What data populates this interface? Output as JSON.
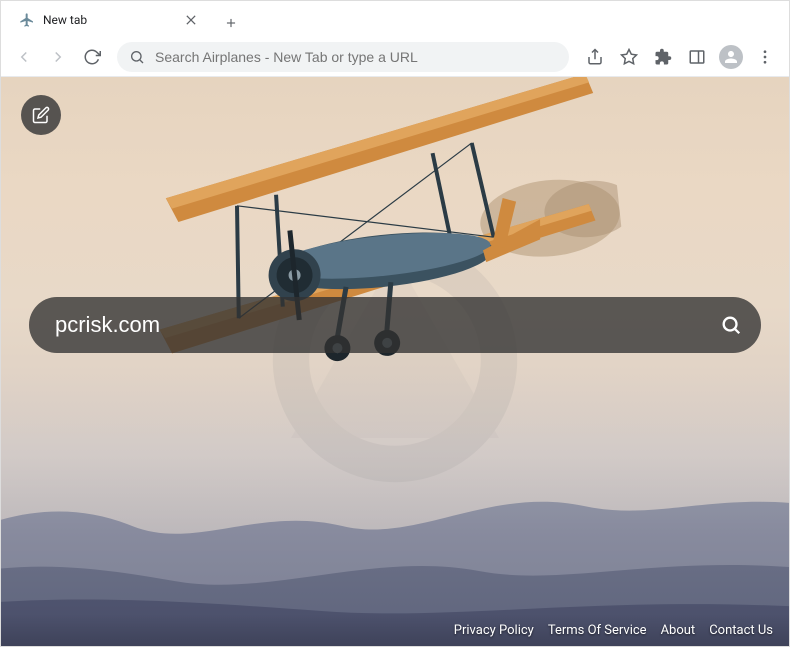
{
  "tab": {
    "title": "New tab"
  },
  "omnibox": {
    "placeholder": "Search Airplanes - New Tab or type a URL"
  },
  "search": {
    "value": "pcrisk.com"
  },
  "footer": {
    "links": [
      "Privacy Policy",
      "Terms Of Service",
      "About",
      "Contact Us"
    ]
  },
  "colors": {
    "searchbar_bg": "rgba(50,50,50,0.78)",
    "edit_btn_bg": "rgba(60,60,60,0.85)",
    "plane_orange": "#cf8a3f",
    "plane_dark": "#3b5260"
  }
}
